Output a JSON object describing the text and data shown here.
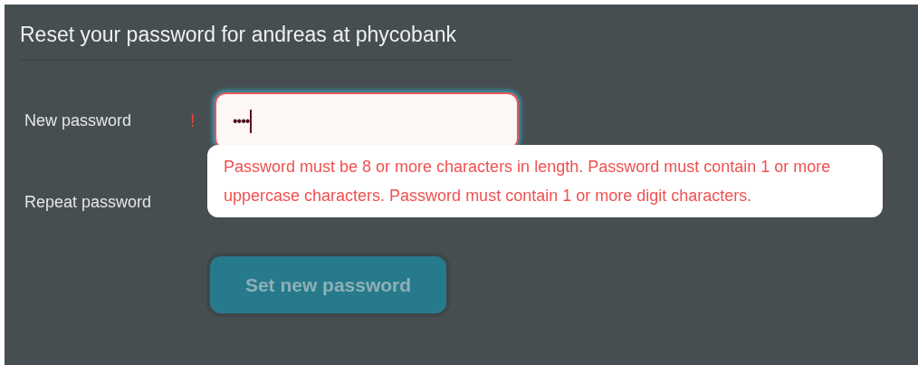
{
  "title": "Reset your password for andreas at phycobank",
  "fields": [
    {
      "label": "New password",
      "value": "••••",
      "invalid": true,
      "error_mark": "!",
      "focused": true
    },
    {
      "label": "Repeat password"
    }
  ],
  "error_tooltip": "Password must be 8 or more characters in length. Password must contain 1 or more uppercase characters. Password must contain 1 or more digit characters.",
  "submit_button": {
    "label": "Set new password",
    "disabled": true
  }
}
